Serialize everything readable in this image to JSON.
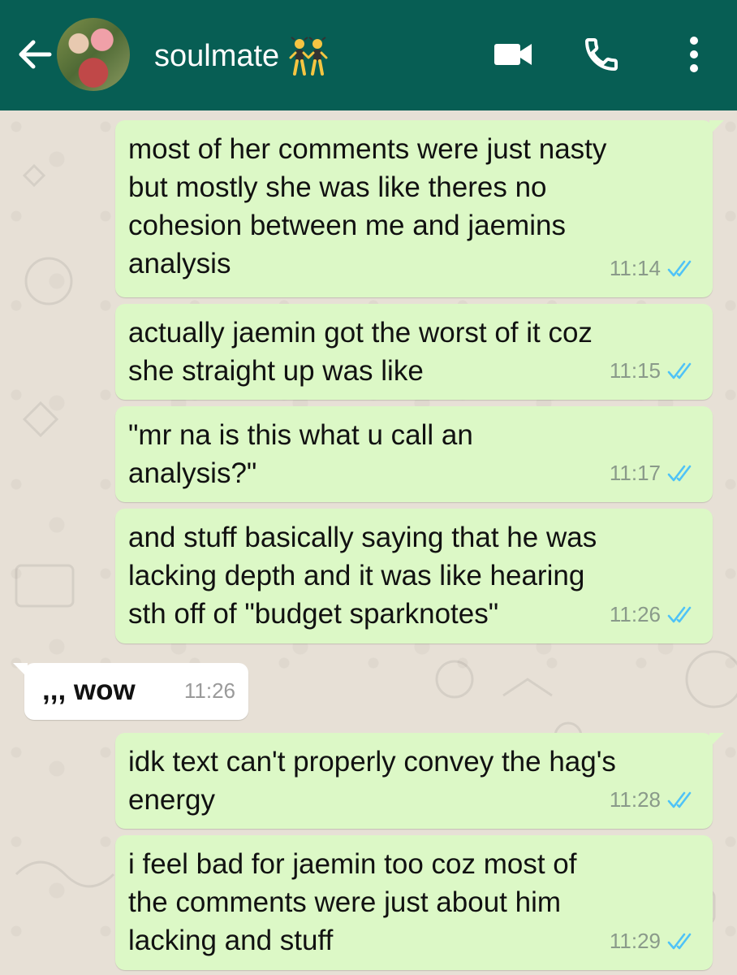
{
  "header": {
    "back_icon": "arrow-left-icon",
    "contact_name": "soulmate",
    "contact_emoji": "👯",
    "video_icon": "video-camera-icon",
    "call_icon": "phone-icon",
    "menu_icon": "more-vertical-icon",
    "color": "#075e54"
  },
  "colors": {
    "outgoing_bubble": "#dcf8c6",
    "incoming_bubble": "#ffffff",
    "read_ticks": "#4fc3f7"
  },
  "messages": [
    {
      "direction": "out",
      "lines": [
        "most of her comments were just nasty",
        "but mostly she was like theres no",
        "cohesion between me and jaemins",
        "analysis"
      ],
      "time": "11:14",
      "status": "read"
    },
    {
      "direction": "out",
      "lines": [
        "actually jaemin got the worst of it coz",
        "she straight up was like"
      ],
      "time": "11:15",
      "status": "read"
    },
    {
      "direction": "out",
      "lines": [
        "\"mr na is this what u call an",
        "analysis?\""
      ],
      "time": "11:17",
      "status": "read"
    },
    {
      "direction": "out",
      "lines": [
        "and stuff basically saying that he was",
        "lacking depth and it was like hearing",
        "sth off of \"budget sparknotes\""
      ],
      "time": "11:26",
      "status": "read"
    },
    {
      "direction": "in",
      "lines": [
        ",,, wow"
      ],
      "time": "11:26"
    },
    {
      "direction": "out",
      "lines": [
        "idk text can't properly convey the hag's",
        "energy"
      ],
      "time": "11:28",
      "status": "read"
    },
    {
      "direction": "out",
      "lines": [
        "i feel bad for jaemin too coz most of",
        "the comments were just about him",
        "lacking and stuff"
      ],
      "time": "11:29",
      "status": "read"
    }
  ]
}
